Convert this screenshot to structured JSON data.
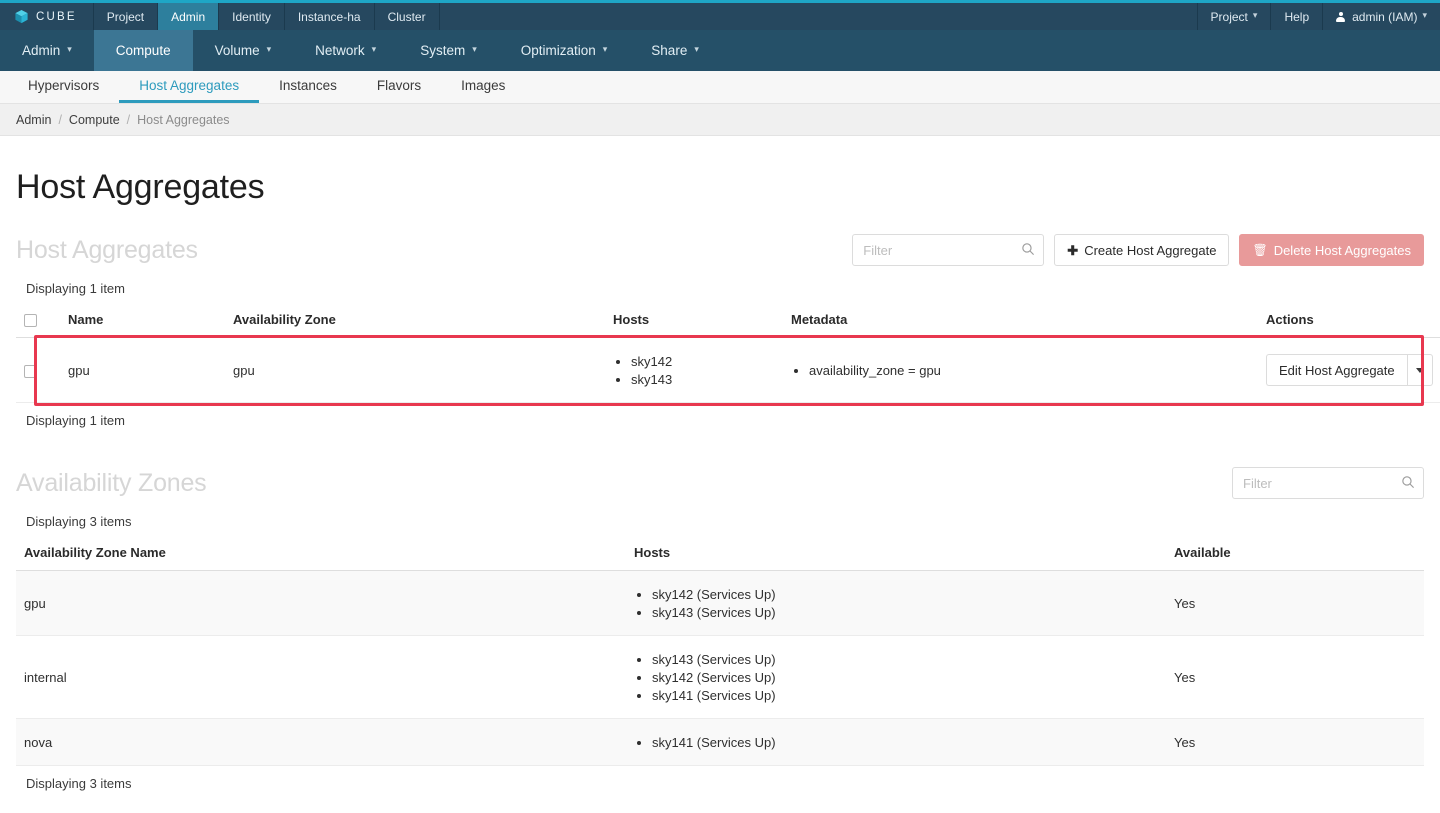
{
  "theme": {
    "accent_cyan": "#1ea6c6",
    "topbar_bg": "#26485f",
    "nav2_bg": "#255068",
    "nav2_active_bg": "#3c7694",
    "tab_active": "#2d9bbd",
    "danger": "#e89a9a",
    "highlight_border": "#e8384f"
  },
  "topbar": {
    "brand": "CUBE",
    "brand_icon": "cube-icon",
    "items": [
      {
        "label": "Project",
        "active": false
      },
      {
        "label": "Admin",
        "active": true
      },
      {
        "label": "Identity",
        "active": false
      },
      {
        "label": "Instance-ha",
        "active": false
      },
      {
        "label": "Cluster",
        "active": false
      }
    ],
    "right_items": [
      {
        "label": "Project",
        "caret": true,
        "icon": "chevron-down-icon"
      },
      {
        "label": "Help",
        "caret": false
      },
      {
        "label": "admin (IAM)",
        "caret": true,
        "icon": "user-icon"
      }
    ]
  },
  "nav2": {
    "items": [
      {
        "label": "Admin",
        "caret": true,
        "active": false
      },
      {
        "label": "Compute",
        "caret": false,
        "active": true
      },
      {
        "label": "Volume",
        "caret": true,
        "active": false
      },
      {
        "label": "Network",
        "caret": true,
        "active": false
      },
      {
        "label": "System",
        "caret": true,
        "active": false
      },
      {
        "label": "Optimization",
        "caret": true,
        "active": false
      },
      {
        "label": "Share",
        "caret": true,
        "active": false
      }
    ]
  },
  "tabs": {
    "items": [
      {
        "label": "Hypervisors",
        "active": false
      },
      {
        "label": "Host Aggregates",
        "active": true
      },
      {
        "label": "Instances",
        "active": false
      },
      {
        "label": "Flavors",
        "active": false
      },
      {
        "label": "Images",
        "active": false
      }
    ]
  },
  "breadcrumb": {
    "items": [
      "Admin",
      "Compute",
      "Host Aggregates"
    ],
    "separator": "/"
  },
  "page": {
    "title": "Host Aggregates"
  },
  "host_aggregates": {
    "section_title": "Host Aggregates",
    "filter_placeholder": "Filter",
    "filter_value": "",
    "create_button": "Create Host Aggregate",
    "delete_button": "Delete Host Aggregates",
    "count_top": "Displaying 1 item",
    "count_bottom": "Displaying 1 item",
    "columns": [
      "",
      "Name",
      "Availability Zone",
      "Hosts",
      "Metadata",
      "Actions"
    ],
    "rows": [
      {
        "name": "gpu",
        "availability_zone": "gpu",
        "hosts": [
          "sky142",
          "sky143"
        ],
        "metadata": [
          "availability_zone = gpu"
        ],
        "action_label": "Edit Host Aggregate",
        "highlighted": true
      }
    ]
  },
  "availability_zones": {
    "section_title": "Availability Zones",
    "filter_placeholder": "Filter",
    "filter_value": "",
    "count_top": "Displaying 3 items",
    "count_bottom": "Displaying 3 items",
    "columns": [
      "Availability Zone Name",
      "Hosts",
      "Available"
    ],
    "rows": [
      {
        "name": "gpu",
        "hosts": [
          "sky142 (Services Up)",
          "sky143 (Services Up)"
        ],
        "available": "Yes"
      },
      {
        "name": "internal",
        "hosts": [
          "sky143 (Services Up)",
          "sky142 (Services Up)",
          "sky141 (Services Up)"
        ],
        "available": "Yes"
      },
      {
        "name": "nova",
        "hosts": [
          "sky141 (Services Up)"
        ],
        "available": "Yes"
      }
    ]
  }
}
